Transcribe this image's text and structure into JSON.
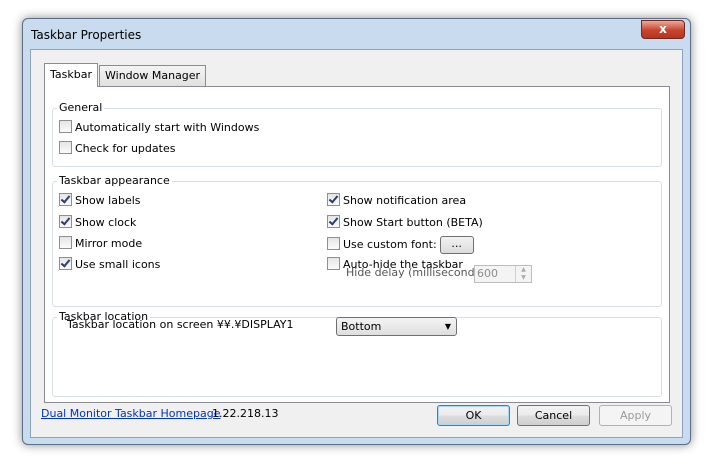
{
  "window": {
    "title": "Taskbar Properties",
    "close_glyph": "x"
  },
  "tabs": [
    {
      "label": "Taskbar",
      "active": true
    },
    {
      "label": "Window Manager",
      "active": false
    }
  ],
  "general": {
    "title": "General",
    "auto_start": {
      "label": "Automatically start with Windows",
      "checked": false
    },
    "check_updates": {
      "label": "Check for updates",
      "checked": false
    }
  },
  "appearance": {
    "title": "Taskbar appearance",
    "show_labels": {
      "label": "Show labels",
      "checked": true
    },
    "show_clock": {
      "label": "Show clock",
      "checked": true
    },
    "mirror_mode": {
      "label": "Mirror mode",
      "checked": false
    },
    "small_icons": {
      "label": "Use small icons",
      "checked": true
    },
    "notification_area": {
      "label": "Show notification area",
      "checked": true
    },
    "start_button": {
      "label": "Show Start button (BETA)",
      "checked": true
    },
    "custom_font": {
      "label": "Use custom font:",
      "checked": false,
      "button_label": "..."
    },
    "auto_hide": {
      "label": "Auto-hide the taskbar",
      "checked": false
    },
    "hide_delay": {
      "label": "Hide delay (milliseconds):",
      "value": "600"
    }
  },
  "location": {
    "title": "Taskbar location",
    "screen_label": "Taskbar location on screen ¥¥.¥DISPLAY1",
    "selected": "Bottom"
  },
  "footer": {
    "homepage_link": "Dual Monitor Taskbar Homepage",
    "version": "1.22.218.13",
    "ok_label": "OK",
    "cancel_label": "Cancel",
    "apply_label": "Apply"
  }
}
